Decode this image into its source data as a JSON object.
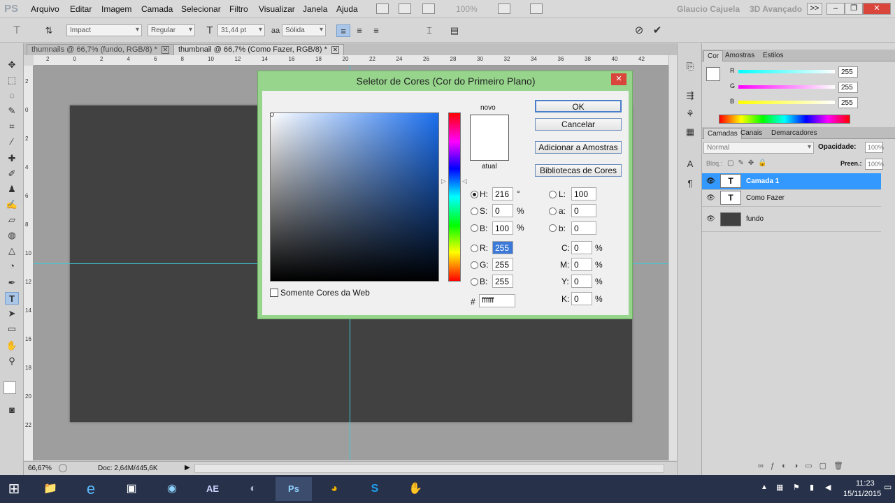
{
  "app": {
    "logo": "PS"
  },
  "menu": [
    "Arquivo",
    "Editar",
    "Imagem",
    "Camada",
    "Selecionar",
    "Filtro",
    "Visualizar",
    "Janela",
    "Ajuda"
  ],
  "menubar_right": {
    "zoom_select": "100%",
    "user": "Glaucio Cajuela",
    "workspace": "3D Avançado",
    "expand": ">>",
    "min": "–",
    "restore": "❐",
    "close": "✕"
  },
  "options": {
    "font_family": "Impact",
    "font_style": "Regular",
    "font_size": "31,44 pt",
    "aa_label": "aa",
    "antialias": "Sólida"
  },
  "tabs": [
    {
      "label": "thumnails @ 66,7% (fundo, RGB/8) *",
      "close": "✕"
    },
    {
      "label": "thumbnail @ 66,7% (Como Fazer, RGB/8) *",
      "close": "✕"
    }
  ],
  "ruler_top_labels": [
    "2",
    "0",
    "2",
    "4",
    "6",
    "8",
    "10",
    "12",
    "14",
    "16",
    "18",
    "20",
    "22",
    "24",
    "26",
    "28",
    "30",
    "32",
    "34",
    "36",
    "38",
    "40",
    "42"
  ],
  "ruler_left_labels": [
    "2",
    "0",
    "2",
    "4",
    "6",
    "8",
    "10",
    "12",
    "14",
    "16",
    "18",
    "20",
    "22"
  ],
  "status": {
    "zoom": "66,67%",
    "doc": "Doc: 2,64M/445,6K"
  },
  "color_panel": {
    "tabs": [
      "Cor",
      "Amostras",
      "Estilos"
    ],
    "r_label": "R",
    "g_label": "G",
    "b_label": "B",
    "r": "255",
    "g": "255",
    "b": "255"
  },
  "layers_panel": {
    "tabs": [
      "Camadas",
      "Canais",
      "Demarcadores"
    ],
    "blend": "Normal",
    "opacity_label": "Opacidade:",
    "opacity": "100%",
    "lock_label": "Bloq.:",
    "fill_label": "Preen.:",
    "fill": "100%",
    "layers": [
      {
        "name": "Camada 1",
        "thumb": "T",
        "selected": true
      },
      {
        "name": "Como Fazer",
        "thumb": "T",
        "selected": false
      },
      {
        "name": "fundo",
        "thumb": "",
        "selected": false
      }
    ]
  },
  "dialog": {
    "title": "Seletor de Cores (Cor do Primeiro Plano)",
    "close": "✕",
    "new_label": "novo",
    "current_label": "atual",
    "ok": "OK",
    "cancel": "Cancelar",
    "add_swatches": "Adicionar a Amostras",
    "libraries": "Bibliotecas de Cores",
    "web_only": "Somente Cores da Web",
    "fields": {
      "H": {
        "label": "H:",
        "value": "216",
        "unit": "°"
      },
      "S": {
        "label": "S:",
        "value": "0",
        "unit": "%"
      },
      "Bv": {
        "label": "B:",
        "value": "100",
        "unit": "%"
      },
      "R": {
        "label": "R:",
        "value": "255"
      },
      "G": {
        "label": "G:",
        "value": "255"
      },
      "Bc": {
        "label": "B:",
        "value": "255"
      },
      "L": {
        "label": "L:",
        "value": "100"
      },
      "a": {
        "label": "a:",
        "value": "0"
      },
      "b": {
        "label": "b:",
        "value": "0"
      },
      "C": {
        "label": "C:",
        "value": "0",
        "unit": "%"
      },
      "M": {
        "label": "M:",
        "value": "0",
        "unit": "%"
      },
      "Y": {
        "label": "Y:",
        "value": "0",
        "unit": "%"
      },
      "K": {
        "label": "K:",
        "value": "0",
        "unit": "%"
      },
      "hex_label": "#",
      "hex": "ffffff"
    }
  },
  "taskbar": {
    "time": "11:23",
    "date": "15/11/2015",
    "ae": "AE",
    "ps": "Ps"
  },
  "colors": {
    "accent": "#3399ff",
    "dialog_frame": "#97d58c",
    "taskbar": "#27324a",
    "close_red": "#d9453b"
  }
}
